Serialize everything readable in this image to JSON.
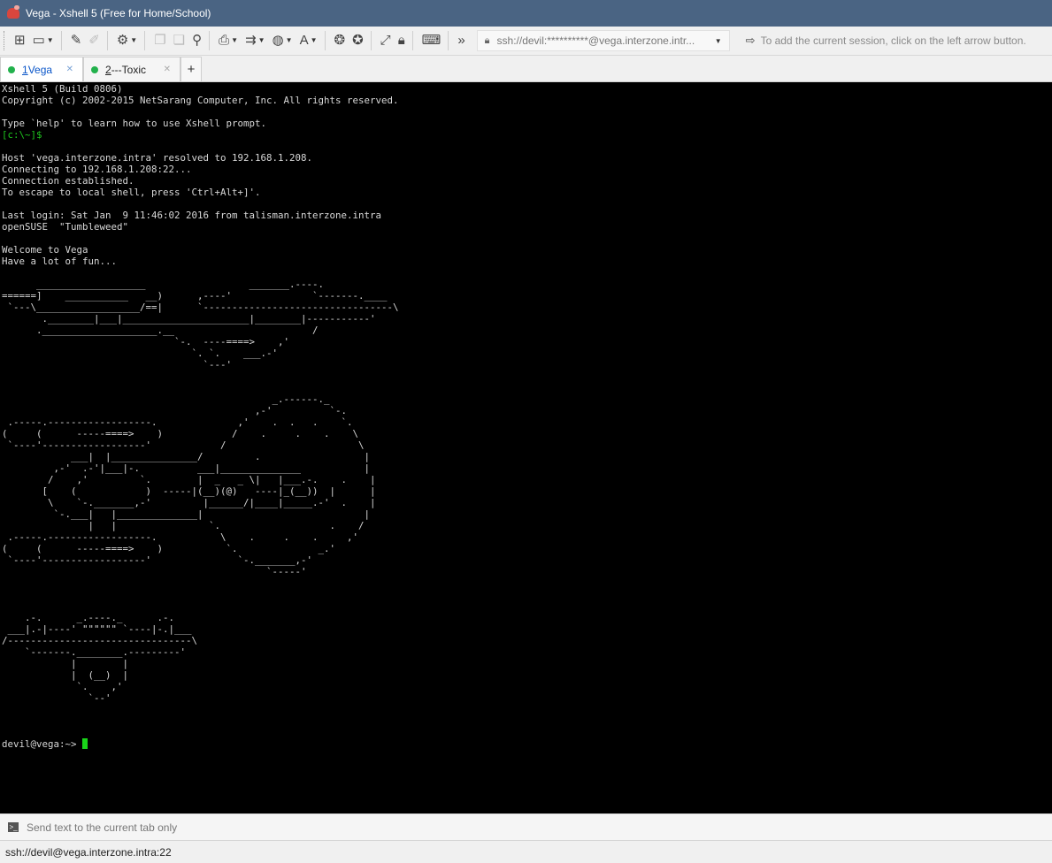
{
  "window": {
    "title": "Vega - Xshell 5 (Free for Home/School)"
  },
  "toolbar": {
    "address": "ssh://devil:**********@vega.interzone.intr...",
    "hint": "To add the current session, click on the left arrow button."
  },
  "tabs": [
    {
      "num": "1",
      "label": " Vega",
      "active": true
    },
    {
      "num": "2",
      "label": " ---Toxic",
      "active": false
    }
  ],
  "terminal": {
    "lines": [
      "Xshell 5 (Build 0806)",
      "Copyright (c) 2002-2015 NetSarang Computer, Inc. All rights reserved.",
      "",
      "Type `help' to learn how to use Xshell prompt.",
      "[c:\\~]$",
      "",
      "Host 'vega.interzone.intra' resolved to 192.168.1.208.",
      "Connecting to 192.168.1.208:22...",
      "Connection established.",
      "To escape to local shell, press 'Ctrl+Alt+]'.",
      "",
      "Last login: Sat Jan  9 11:46:02 2016 from talisman.interzone.intra",
      "openSUSE  \"Tumbleweed\"",
      "",
      "Welcome to Vega",
      "Have a lot of fun...",
      "",
      "      ___________________                  _______.----.",
      "======]    ___________   __)      ,----'              `-------.____",
      " `---\\__________________/==|      `---------------------------------\\",
      "       .________|___|______________________|________|-----------'",
      "      .____________________.__                        /",
      "                              `-.  ----====>    ,'",
      "                                 `. `.    ___.-'",
      "                                   `---'",
      "",
      "",
      "                                               _.------._",
      "                                            ,-'          `-.",
      " .-----.------------------.              ,'    .  .   .    `.",
      "(     (      -----====>    )            /    .     .    .    \\",
      " `----'------------------'            /                       \\",
      "            ___|  |_______________/         .                  |",
      "         ,-'  .-'|___|-.          ___|______________           |",
      "        /    ,'         `.        |  _   _ \\|   |___.-.    .    |",
      "       [    (            )  -----|(__)(@)   ----|_(__))  |      |",
      "        \\    `-._______,-'         |______/|____|_____.-'  .    |",
      "         `-.___|   |______________|                            |",
      "               |   |                `.                   .    /",
      " .-----.------------------.           \\    .     .    .     ,'",
      "(     (      -----====>    )           `.              _.'",
      " `----'------------------'               `-._______,-'",
      "                                              `-----'",
      "",
      "",
      "",
      "    .-.      _.----._      .-.",
      " ___|.-|----' \"\"\"\"\"\" `----|-.|___",
      "/--------------------------------\\",
      "    `-------.________.---------'",
      "            |        |",
      "            |  (__)  |",
      "             `.    ,'",
      "               `--'",
      "",
      "",
      "",
      "devil@vega:~> "
    ]
  },
  "compose": {
    "placeholder": "Send text to the current tab only"
  },
  "status": {
    "text": "ssh://devil@vega.interzone.intra:22"
  }
}
